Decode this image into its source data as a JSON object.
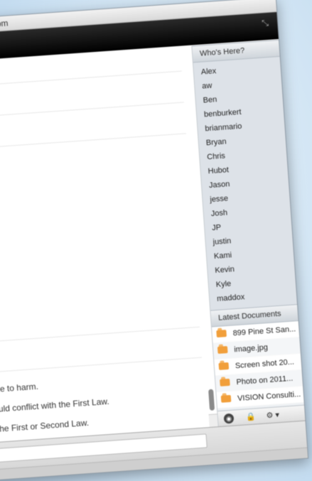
{
  "window": {
    "title": "Room"
  },
  "chat": {
    "messages": [
      {
        "text": "o come to harm."
      },
      {
        "text": "rs would conflict with the First Law."
      },
      {
        "text": "with the First or Second Law."
      }
    ]
  },
  "presence": {
    "header": "Who's Here?",
    "users": [
      "Alex",
      "aw",
      "Ben",
      "benburkert",
      "brianmario",
      "Bryan",
      "Chris",
      "Hubot",
      "Jason",
      "jesse",
      "Josh",
      "JP",
      "justin",
      "Kami",
      "Kevin",
      "Kyle",
      "maddox"
    ]
  },
  "documents": {
    "header": "Latest Documents",
    "items": [
      "899 Pine St San...",
      "image.jpg",
      "Screen shot 20...",
      "Photo on 2011...",
      "VISION Consulti..."
    ]
  },
  "toolbar": {
    "gear_label": "⚙ ▾"
  },
  "colors": {
    "accent_file_icon": "#f19f3b",
    "title_bar_dark": "#000000",
    "panel_bg": "#dde2e8"
  }
}
